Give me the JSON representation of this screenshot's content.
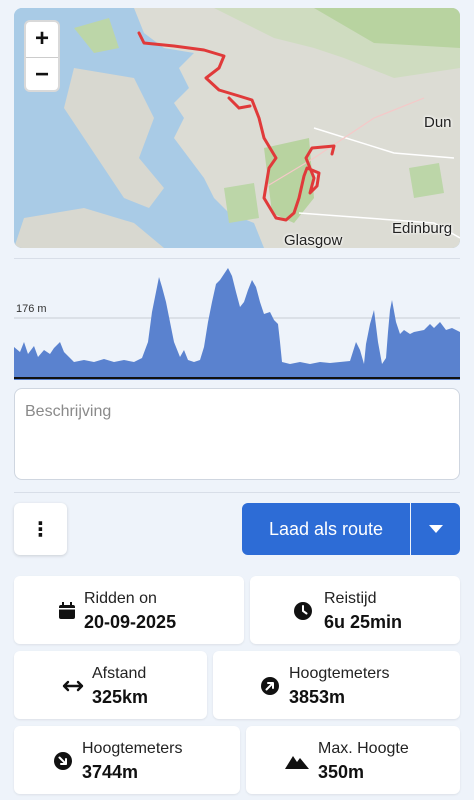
{
  "map": {
    "zoom_in": "+",
    "zoom_out": "−",
    "labels": {
      "glasgow": "Glasgow",
      "edinburgh": "Edinburg",
      "dundee": "Dun"
    },
    "route_color": "#e03a3a"
  },
  "elevation": {
    "label": "176 m",
    "fill_color": "#5a82cf"
  },
  "description": {
    "placeholder": "Beschrijving"
  },
  "actions": {
    "more": "⋮",
    "load_route": "Laad als route"
  },
  "stats": {
    "ridden_on": {
      "label": "Ridden on",
      "value": "20-09-2025",
      "icon": "calendar-icon"
    },
    "travel_time": {
      "label": "Reistijd",
      "value": "6u 25min",
      "icon": "clock-icon"
    },
    "distance": {
      "label": "Afstand",
      "value": "325km",
      "icon": "horizontal-arrows-icon"
    },
    "ascent": {
      "label": "Hoogtemeters",
      "value": "3853m",
      "icon": "arrow-up-right-icon"
    },
    "descent": {
      "label": "Hoogtemeters",
      "value": "3744m",
      "icon": "arrow-down-right-icon"
    },
    "max_height": {
      "label": "Max. Hoogte",
      "value": "350m",
      "icon": "mountain-icon"
    }
  },
  "colors": {
    "accent": "#2d6cd6",
    "background": "#eef3fa"
  }
}
